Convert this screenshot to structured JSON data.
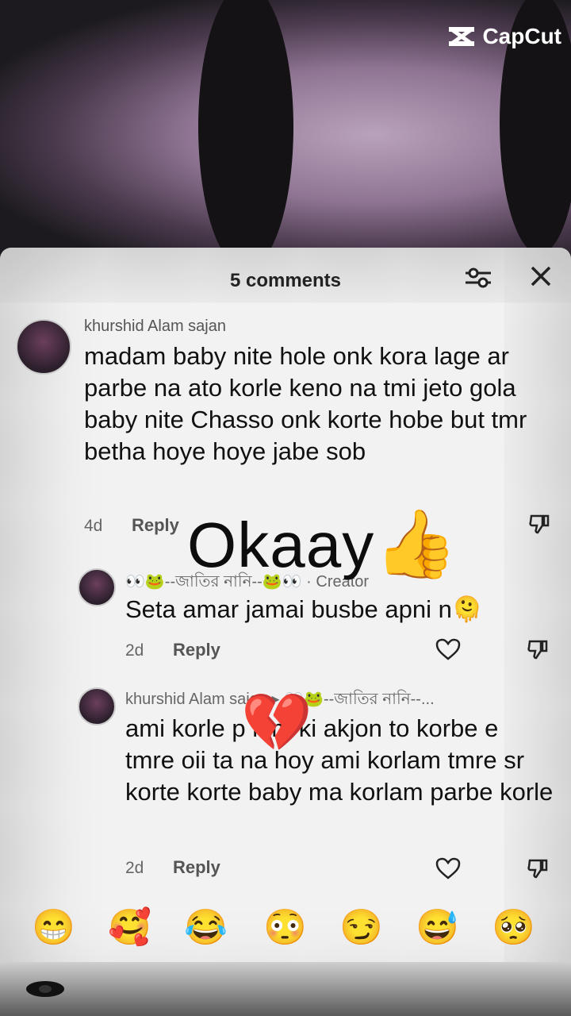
{
  "watermark": {
    "brand": "CapCut"
  },
  "sheet": {
    "title": "5 comments"
  },
  "comments": [
    {
      "username": "khurshid Alam sajan",
      "text": "madam baby nite hole onk kora lage ar parbe na ato korle keno na tmi jeto gola baby nite Chasso onk korte hobe but tmr betha hoye hoye jabe sob",
      "age": "4d",
      "reply_label": "Reply"
    },
    {
      "username": "👀🐸--জাতির নানি--🐸👀 · Creator",
      "text": "Seta amar jamai busbe apni n🫠",
      "age": "2d",
      "reply_label": "Reply"
    },
    {
      "username": "khurshid Alam sajan ▸ 👀🐸--জাতির নানি--...",
      "text": "ami korle p  lem ki akjon to korbe e tmre oii ta na hoy ami korlam tmre sr korte korte baby ma korlam parbe korle",
      "age": "2d",
      "reply_label": "Reply"
    }
  ],
  "overlay": {
    "text": "Okaay",
    "thumbs": "👍",
    "broken_heart": "💔"
  },
  "emoji_bar": [
    "😁",
    "🥰",
    "😂",
    "😳",
    "😏",
    "😅",
    "🥺"
  ]
}
